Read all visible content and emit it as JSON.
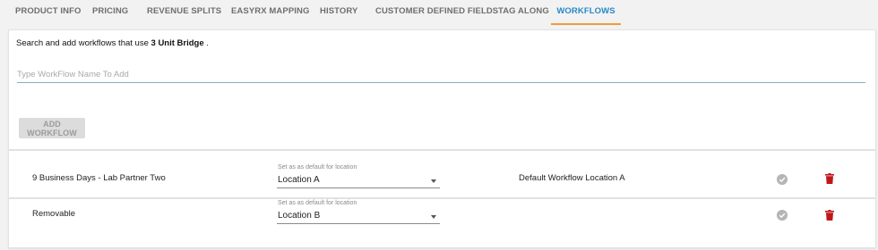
{
  "tabs": [
    {
      "label": "PRODUCT INFO"
    },
    {
      "label": "PRICING"
    },
    {
      "label": "REVENUE SPLITS"
    },
    {
      "label": "EASYRX MAPPING"
    },
    {
      "label": "HISTORY"
    },
    {
      "label": "CUSTOMER DEFINED FIELDS"
    },
    {
      "label": "TAG ALONG"
    },
    {
      "label": "WORKFLOWS"
    }
  ],
  "active_tab": "WORKFLOWS",
  "intro": {
    "prefix": "Search and add workflows that use ",
    "product": "3 Unit Bridge",
    "suffix": " ."
  },
  "search": {
    "placeholder": "Type WorkFlow Name To Add",
    "value": ""
  },
  "add_button_label": "ADD WORKFLOW",
  "workflows": [
    {
      "name": "9 Business Days - Lab Partner Two",
      "location_label": "Set as as default for location",
      "location": "Location A",
      "default_text": "Default Workflow Location A"
    },
    {
      "name": "Removable",
      "location_label": "Set as as default for location",
      "location": "Location B",
      "default_text": ""
    }
  ],
  "colors": {
    "active_tab_text": "#2a89c6",
    "active_tab_underline": "#ee9b3a",
    "delete_icon": "#c0161b",
    "check_icon": "#b5b5b5"
  }
}
